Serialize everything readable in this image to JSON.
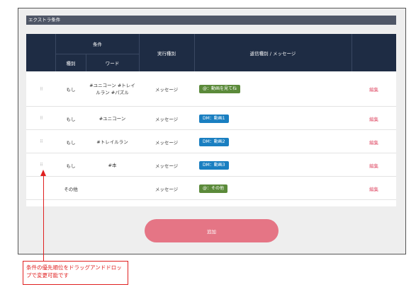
{
  "section_title": "エクストラ条件",
  "header": {
    "condition": "条件",
    "type": "種別",
    "word": "ワード",
    "exec_type": "実行種別",
    "reply": "返信種別 / メッセージ"
  },
  "rows": [
    {
      "type": "もし",
      "word": "#ユニコーン #トレイルラン #パズル",
      "exec": "メッセージ",
      "reply": "@：動画を見てね",
      "reply_color": "#5b8a3a",
      "edit": "編集",
      "has_handle": true
    },
    {
      "type": "もし",
      "word": "#ユニコーン",
      "exec": "メッセージ",
      "reply": "DM：動画1",
      "reply_color": "#1a7fc1",
      "edit": "編集",
      "has_handle": true
    },
    {
      "type": "もし",
      "word": "#トレイルラン",
      "exec": "メッセージ",
      "reply": "DM：動画2",
      "reply_color": "#1a7fc1",
      "edit": "編集",
      "has_handle": true
    },
    {
      "type": "もし",
      "word": "#本",
      "exec": "メッセージ",
      "reply": "DM：動画3",
      "reply_color": "#1a7fc1",
      "edit": "編集",
      "has_handle": true
    },
    {
      "type": "その他",
      "word": "",
      "exec": "メッセージ",
      "reply": "@：その他",
      "reply_color": "#5b8a3a",
      "edit": "編集",
      "has_handle": false
    }
  ],
  "handle_glyph": "⠿",
  "add_button": "追加",
  "annotation": "条件の優先順位をドラッグアンドドロップで変更可能です",
  "colors": {
    "header_bg": "#1e2c44",
    "section_bg": "#4f5666",
    "add_button": "#e57585",
    "annotation": "#e02020"
  }
}
